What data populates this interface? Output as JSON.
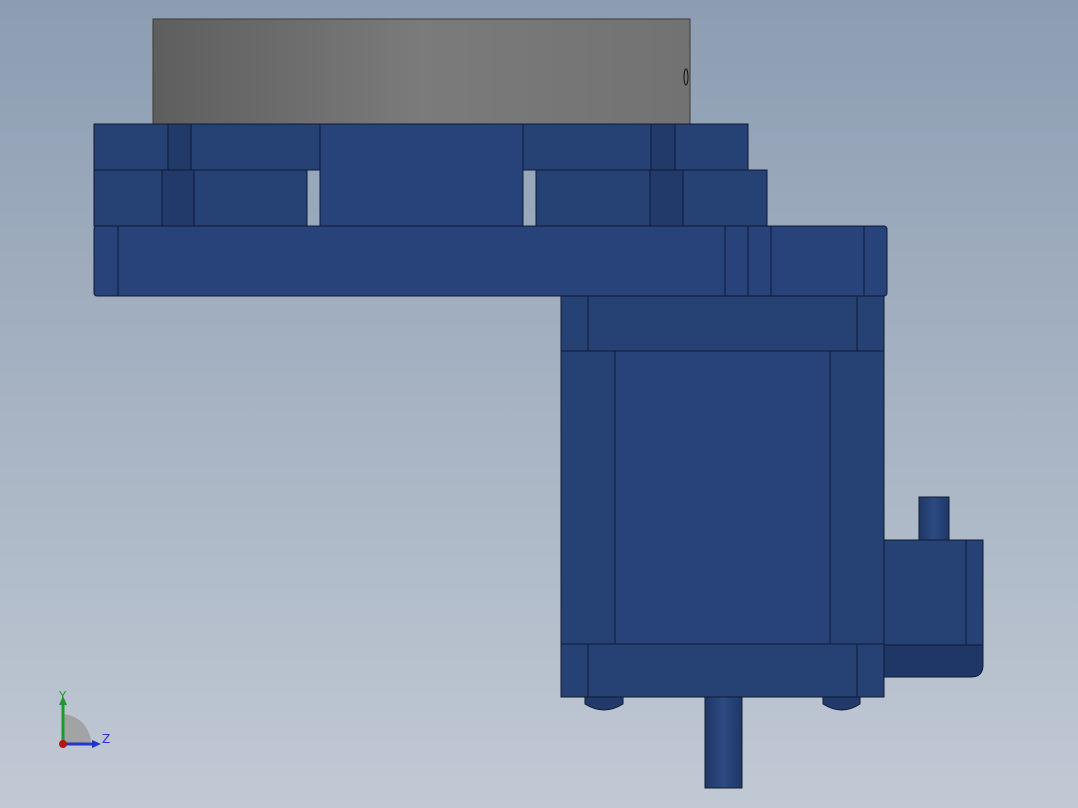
{
  "viewport": {
    "background_top": "#8c9db2",
    "background_bottom": "#c1c9d4"
  },
  "model": {
    "part_color": "#264174",
    "part_edge_color": "#0f1b33",
    "top_plate_color": "#7a7a7a"
  },
  "triad": {
    "y_label": "Y",
    "z_label": "Z",
    "y_color": "#1e9a2a",
    "z_color": "#2436c8",
    "x_color": "#b01818"
  }
}
